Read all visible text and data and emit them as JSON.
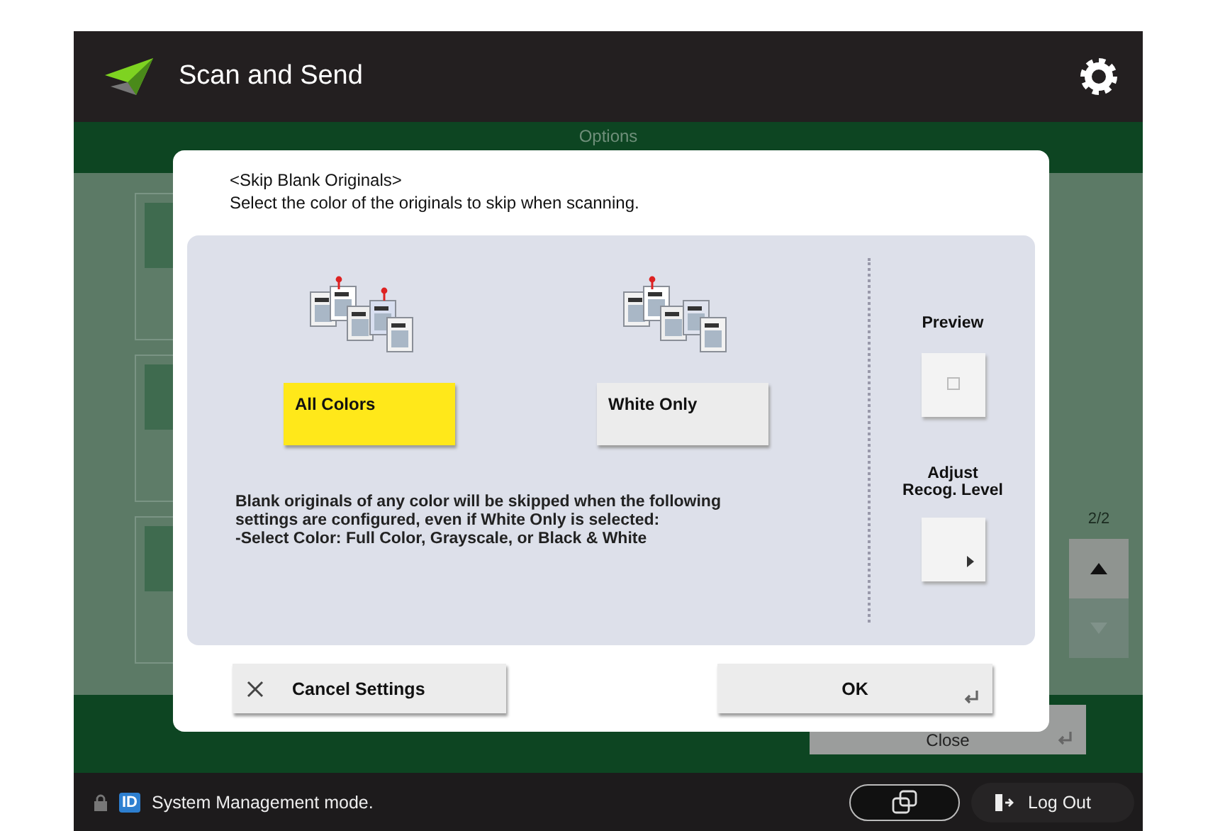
{
  "header": {
    "title": "Scan and Send"
  },
  "options_bar": {
    "title": "Options"
  },
  "side_panel": {
    "page": "2/2",
    "up_disabled": false,
    "down_disabled": true
  },
  "close_button": {
    "label": "Close"
  },
  "dialog": {
    "title": "<Skip Blank Originals>",
    "instruction": "Select the color of the originals to skip when scanning.",
    "choices": [
      {
        "label": "All Colors",
        "selected": true,
        "kind": "all"
      },
      {
        "label": "White Only",
        "selected": false,
        "kind": "white"
      }
    ],
    "note": "Blank originals of any color will be skipped when the following\nsettings are configured, even if White Only is selected:\n-Select Color: Full Color, Grayscale, or Black & White",
    "preview": {
      "label": "Preview",
      "checked": false
    },
    "adjust": {
      "label": "Adjust\nRecog. Level"
    },
    "cancel_button": "Cancel Settings",
    "ok_button": "OK"
  },
  "status_bar": {
    "id_badge": "ID",
    "mode": "System Management mode.",
    "logout": "Log Out"
  }
}
